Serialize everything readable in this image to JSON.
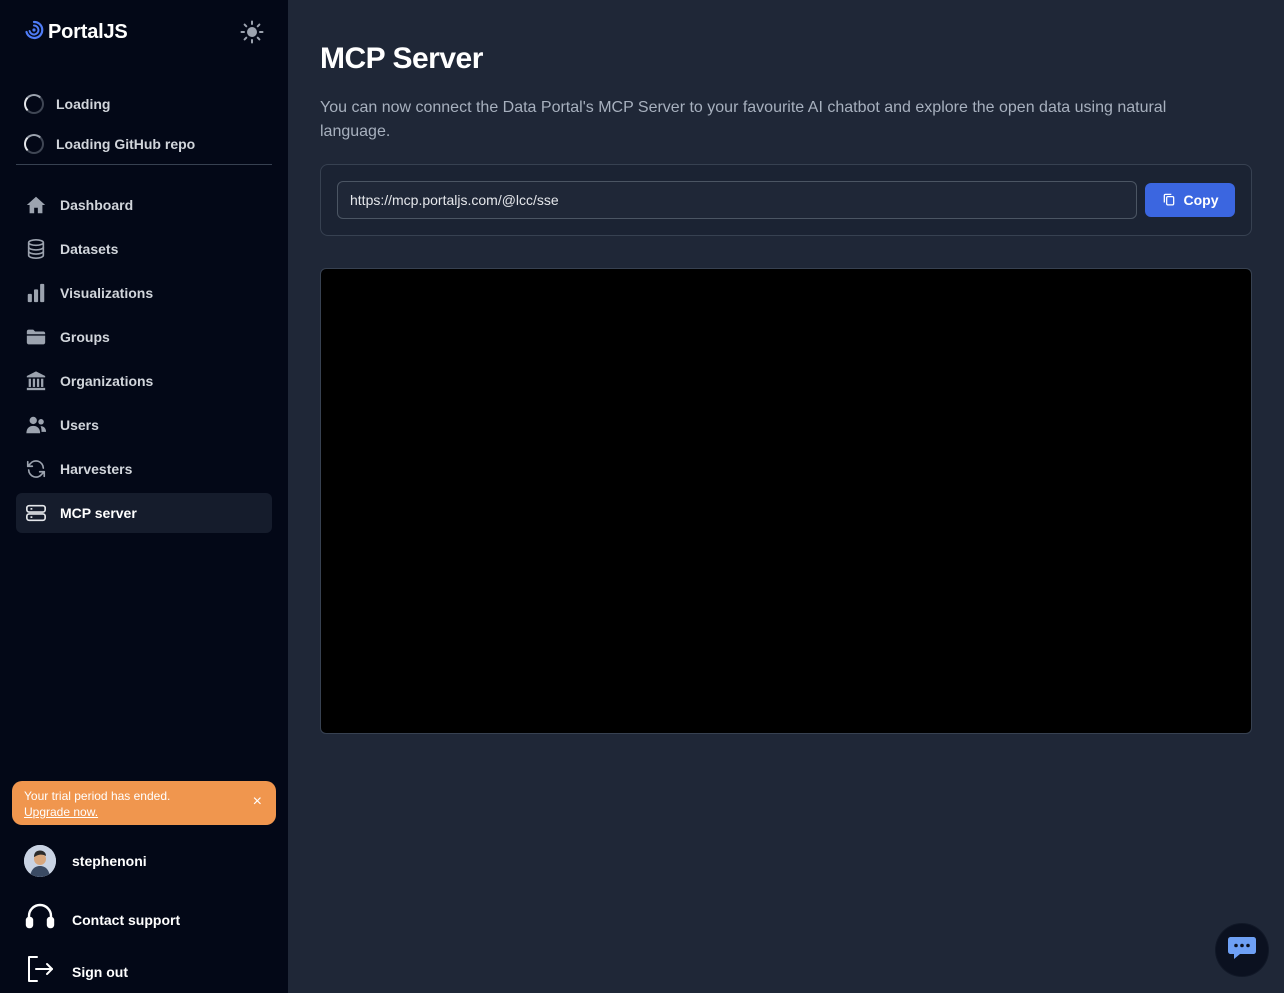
{
  "brand": {
    "name": "PortalJS"
  },
  "loading": [
    {
      "label": "Loading"
    },
    {
      "label": "Loading GitHub repo"
    }
  ],
  "nav": {
    "items": [
      {
        "label": "Dashboard",
        "icon": "home-icon"
      },
      {
        "label": "Datasets",
        "icon": "database-icon"
      },
      {
        "label": "Visualizations",
        "icon": "bar-chart-icon"
      },
      {
        "label": "Groups",
        "icon": "folder-icon"
      },
      {
        "label": "Organizations",
        "icon": "building-icon"
      },
      {
        "label": "Users",
        "icon": "users-icon"
      },
      {
        "label": "Harvesters",
        "icon": "refresh-icon"
      },
      {
        "label": "MCP server",
        "icon": "server-icon",
        "active": true
      }
    ]
  },
  "trial": {
    "message": "Your trial period has ended.",
    "link": "Upgrade now.",
    "close": "×"
  },
  "user": {
    "name": "stephenoni"
  },
  "support": {
    "label": "Contact support"
  },
  "signout": {
    "label": "Sign out"
  },
  "main": {
    "title": "MCP Server",
    "description": "You can now connect the Data Portal's MCP Server to your favourite AI chatbot and explore the open data using natural language.",
    "url_value": "https://mcp.portaljs.com/@lcc/sse",
    "copy_label": "Copy"
  },
  "colors": {
    "accent": "#3b66e0",
    "trial_bg": "#f0964e",
    "sidebar_bg": "#030817",
    "main_bg": "#1f2737"
  }
}
